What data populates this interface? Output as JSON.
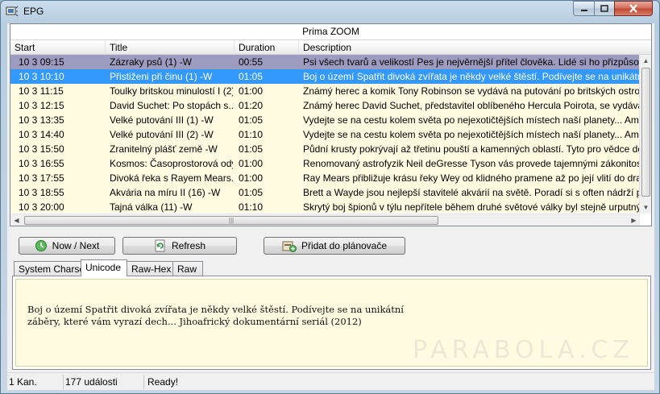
{
  "window": {
    "title": "EPG"
  },
  "channel": {
    "name": "Prima ZOOM"
  },
  "columns": [
    "Start",
    "Title",
    "Duration",
    "Description"
  ],
  "rows": [
    {
      "start": "10 3 09:15",
      "title": "Zázraky psů (1) -W",
      "duration": "00:55",
      "description": "Psi všech tvarů a velikostí Pes je nejvěrnější přítel člověka. Lidé si ho přizpůsobili natolik"
    },
    {
      "start": "10 3 10:10",
      "title": "Přistiženi při činu (1) -W",
      "duration": "01:05",
      "description": "Boj o území Spatřit divoká zvířata je někdy velké štěstí. Podívejte se na unikátní záběry,"
    },
    {
      "start": "10 3 11:15",
      "title": "Toulky britskou minulostí I (2)...",
      "duration": "01:00",
      "description": "Známý herec a komik Tony Robinson se vydává na putování po britských ostrovech, aby"
    },
    {
      "start": "10 3 12:15",
      "title": "David Suchet: Po stopách s...",
      "duration": "01:20",
      "description": "Známý herec David Suchet, představitel oblíbeného Hercula Poirota, se vydává na další"
    },
    {
      "start": "10 3 13:35",
      "title": "Velké putování III (1) -W",
      "duration": "01:05",
      "description": "Vydejte se na cestu kolem světa po nejexotičtějších místech naší planety... Americký dok"
    },
    {
      "start": "10 3 14:40",
      "title": "Velké putování III (2) -W",
      "duration": "01:10",
      "description": "Vydejte se na cestu kolem světa po nejexotičtějších místech naší planety... Americký dok"
    },
    {
      "start": "10 3 15:50",
      "title": "Zranitelný plášť země -W",
      "duration": "01:05",
      "description": "Půdní krusty pokrývají až třetinu pouští a kamenných oblastí.  Tyto pro vědce donedávna"
    },
    {
      "start": "10 3 16:55",
      "title": "Kosmos: Časoprostorová ody...",
      "duration": "01:00",
      "description": "Renomovaný astrofyzik Neil deGresse Tyson vás provede tajemnými zákonitostmi přírody"
    },
    {
      "start": "10 3 17:55",
      "title": "Divoká řeka s Rayem Mears...",
      "duration": "01:00",
      "description": "Ray Mears přibližuje krásu řeky Wey od klidného pramene až po její vlití do dravé řeky S"
    },
    {
      "start": "10 3 18:55",
      "title": "Akvária na míru II (16) -W",
      "duration": "01:05",
      "description": "Brett a Wayde jsou nejlepší stavitelé akvárií na světě. Poradí si s often nádrží pro žraloky i"
    },
    {
      "start": "10 3 20:00",
      "title": "Tajná válka (11) -W",
      "duration": "01:10",
      "description": "Skrytý boj špionů v týlu nepřítele během druhé světové války byl stejně urputný a vražedn"
    }
  ],
  "buttons": {
    "now_next": "Now / Next",
    "refresh": "Refresh",
    "add_to_planner": "Přidat do plánovače"
  },
  "tabs": [
    "System Charset",
    "Unicode",
    "Raw-Hex",
    "Raw"
  ],
  "selected_tab": "Unicode",
  "detail_text": "Boj o území Spatřit divoká zvířata je někdy velké štěstí. Podívejte se na unikátní záběry, které vám vyrazí dech... Jihoafrický dokumentární seriál (2012)",
  "watermark": "PARABOLA.CZ",
  "status": {
    "channels": "1 Kan.",
    "events": "177 události",
    "message": "Ready!"
  },
  "colors": {
    "row_bg": "#fffbe1",
    "selected_row": "#3399ff",
    "inactive_selected_row": "#9c9cc1",
    "close_button": "#c14a34"
  }
}
